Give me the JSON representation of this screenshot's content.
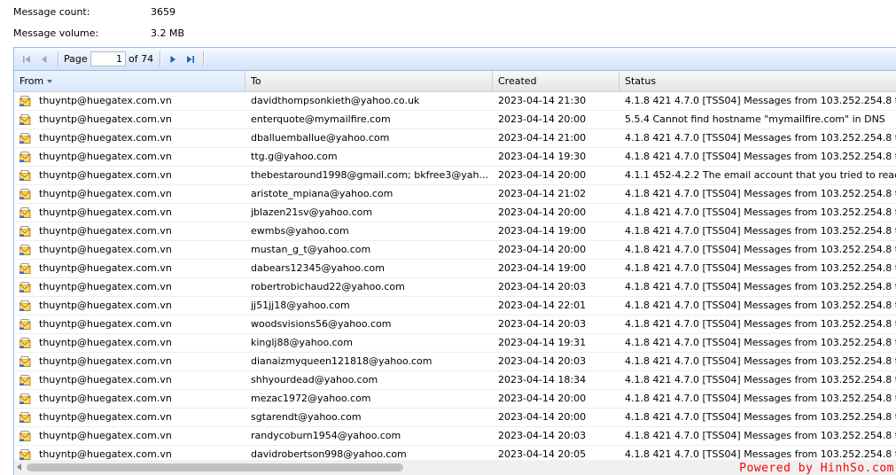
{
  "stats": {
    "message_count_label": "Message count:",
    "message_count_value": "3659",
    "message_volume_label": "Message volume:",
    "message_volume_value": "3.2 MB"
  },
  "pager": {
    "page_label": "Page",
    "page_value": "1",
    "of_total": "of 74"
  },
  "columns": {
    "from": "From",
    "to": "To",
    "created": "Created",
    "status": "Status"
  },
  "rows": [
    {
      "from": "thuyntp@huegatex.com.vn",
      "to": "davidthompsonkieth@yahoo.co.uk",
      "created": "2023-04-14 21:30",
      "status": "4.1.8 421 4.7.0 [TSS04] Messages from 103.252.254.8 t"
    },
    {
      "from": "thuyntp@huegatex.com.vn",
      "to": "enterquote@mymailfire.com",
      "created": "2023-04-14 20:00",
      "status": "5.5.4 Cannot find hostname \"mymailfire.com\" in DNS"
    },
    {
      "from": "thuyntp@huegatex.com.vn",
      "to": "dballuemballue@yahoo.com",
      "created": "2023-04-14 21:00",
      "status": "4.1.8 421 4.7.0 [TSS04] Messages from 103.252.254.8 t"
    },
    {
      "from": "thuyntp@huegatex.com.vn",
      "to": "ttg.g@yahoo.com",
      "created": "2023-04-14 19:30",
      "status": "4.1.8 421 4.7.0 [TSS04] Messages from 103.252.254.8 t"
    },
    {
      "from": "thuyntp@huegatex.com.vn",
      "to": "thebestaround1998@gmail.com; bkfree3@yah...",
      "created": "2023-04-14 20:00",
      "status": "4.1.1 452-4.2.2 The email account that you tried to reac"
    },
    {
      "from": "thuyntp@huegatex.com.vn",
      "to": "aristote_mpiana@yahoo.com",
      "created": "2023-04-14 21:02",
      "status": "4.1.8 421 4.7.0 [TSS04] Messages from 103.252.254.8 t"
    },
    {
      "from": "thuyntp@huegatex.com.vn",
      "to": "jblazen21sv@yahoo.com",
      "created": "2023-04-14 20:00",
      "status": "4.1.8 421 4.7.0 [TSS04] Messages from 103.252.254.8 t"
    },
    {
      "from": "thuyntp@huegatex.com.vn",
      "to": "ewmbs@yahoo.com",
      "created": "2023-04-14 19:00",
      "status": "4.1.8 421 4.7.0 [TSS04] Messages from 103.252.254.8 t"
    },
    {
      "from": "thuyntp@huegatex.com.vn",
      "to": "mustan_g_t@yahoo.com",
      "created": "2023-04-14 20:00",
      "status": "4.1.8 421 4.7.0 [TSS04] Messages from 103.252.254.8 t"
    },
    {
      "from": "thuyntp@huegatex.com.vn",
      "to": "dabears12345@yahoo.com",
      "created": "2023-04-14 19:00",
      "status": "4.1.8 421 4.7.0 [TSS04] Messages from 103.252.254.8 t"
    },
    {
      "from": "thuyntp@huegatex.com.vn",
      "to": "robertrobichaud22@yahoo.com",
      "created": "2023-04-14 20:03",
      "status": "4.1.8 421 4.7.0 [TSS04] Messages from 103.252.254.8 t"
    },
    {
      "from": "thuyntp@huegatex.com.vn",
      "to": "jj51jj18@yahoo.com",
      "created": "2023-04-14 22:01",
      "status": "4.1.8 421 4.7.0 [TSS04] Messages from 103.252.254.8 t"
    },
    {
      "from": "thuyntp@huegatex.com.vn",
      "to": "woodsvisions56@yahoo.com",
      "created": "2023-04-14 20:03",
      "status": "4.1.8 421 4.7.0 [TSS04] Messages from 103.252.254.8 t"
    },
    {
      "from": "thuyntp@huegatex.com.vn",
      "to": "kinglj88@yahoo.com",
      "created": "2023-04-14 19:31",
      "status": "4.1.8 421 4.7.0 [TSS04] Messages from 103.252.254.8 t"
    },
    {
      "from": "thuyntp@huegatex.com.vn",
      "to": "dianaizmyqueen121818@yahoo.com",
      "created": "2023-04-14 20:03",
      "status": "4.1.8 421 4.7.0 [TSS04] Messages from 103.252.254.8 t"
    },
    {
      "from": "thuyntp@huegatex.com.vn",
      "to": "shhyourdead@yahoo.com",
      "created": "2023-04-14 18:34",
      "status": "4.1.8 421 4.7.0 [TSS04] Messages from 103.252.254.8 t"
    },
    {
      "from": "thuyntp@huegatex.com.vn",
      "to": "mezac1972@yahoo.com",
      "created": "2023-04-14 20:00",
      "status": "4.1.8 421 4.7.0 [TSS04] Messages from 103.252.254.8 t"
    },
    {
      "from": "thuyntp@huegatex.com.vn",
      "to": "sgtarendt@yahoo.com",
      "created": "2023-04-14 20:00",
      "status": "4.1.8 421 4.7.0 [TSS04] Messages from 103.252.254.8 t"
    },
    {
      "from": "thuyntp@huegatex.com.vn",
      "to": "randycoburn1954@yahoo.com",
      "created": "2023-04-14 20:03",
      "status": "4.1.8 421 4.7.0 [TSS04] Messages from 103.252.254.8 t"
    },
    {
      "from": "thuyntp@huegatex.com.vn",
      "to": "davidrobertson998@yahoo.com",
      "created": "2023-04-14 20:05",
      "status": "4.1.8 421 4.7.0 [TSS04] Messages from 103.252.254.8 t"
    }
  ],
  "icons": {
    "row_icon": "envelope-icon",
    "first_page": "first-page-icon",
    "prev_page": "prev-page-icon",
    "next_page": "next-page-icon",
    "last_page": "last-page-icon",
    "sort": "sort-desc-icon"
  },
  "colors": {
    "grid_border": "#99bbe8",
    "icon_blue": "#1565c0",
    "watermark": "#ff0000"
  },
  "watermark": "Powered by HinhSo.com"
}
